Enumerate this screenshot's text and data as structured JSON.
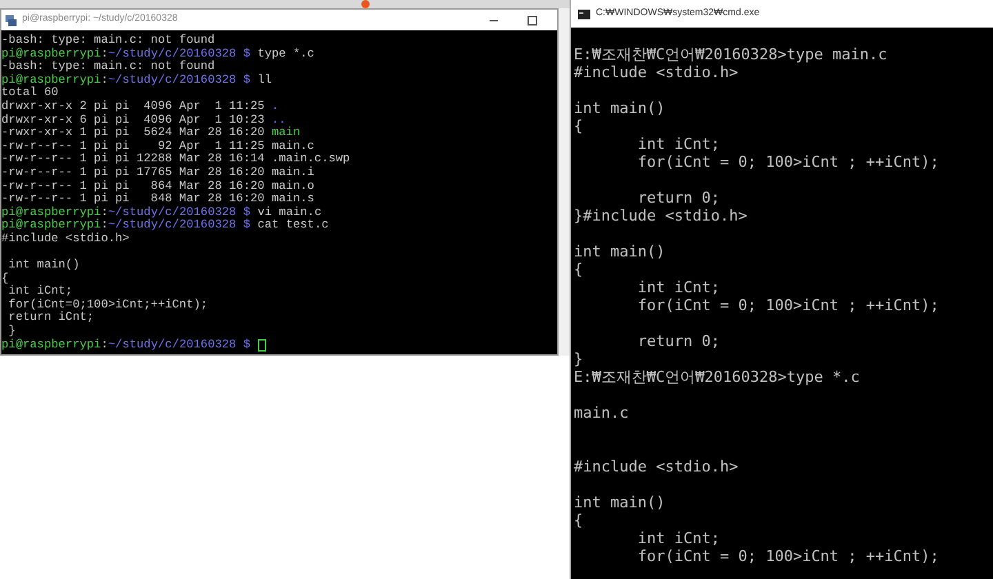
{
  "terminal": {
    "title": "pi@raspberrypi: ~/study/c/20160328",
    "lines": [
      {
        "segments": [
          {
            "text": "-bash: type: main.c: not found",
            "kind": "text"
          }
        ]
      },
      {
        "segments": [
          {
            "text": "pi@raspberrypi",
            "kind": "user"
          },
          {
            "text": ":",
            "kind": "text"
          },
          {
            "text": "~/study/c/20160328 $",
            "kind": "path"
          },
          {
            "text": " type *.c",
            "kind": "text"
          }
        ]
      },
      {
        "segments": [
          {
            "text": "-bash: type: main.c: not found",
            "kind": "text"
          }
        ]
      },
      {
        "segments": [
          {
            "text": "pi@raspberrypi",
            "kind": "user"
          },
          {
            "text": ":",
            "kind": "text"
          },
          {
            "text": "~/study/c/20160328 $",
            "kind": "path"
          },
          {
            "text": " ll",
            "kind": "text"
          }
        ]
      },
      {
        "segments": [
          {
            "text": "total 60",
            "kind": "text"
          }
        ]
      },
      {
        "segments": [
          {
            "text": "drwxr-xr-x 2 pi pi  4096 Apr  1 11:25 ",
            "kind": "text"
          },
          {
            "text": ".",
            "kind": "dir"
          }
        ]
      },
      {
        "segments": [
          {
            "text": "drwxr-xr-x 6 pi pi  4096 Apr  1 10:23 ",
            "kind": "text"
          },
          {
            "text": "..",
            "kind": "dir"
          }
        ]
      },
      {
        "segments": [
          {
            "text": "-rwxr-xr-x 1 pi pi  5624 Mar 28 16:20 ",
            "kind": "text"
          },
          {
            "text": "main",
            "kind": "exec"
          }
        ]
      },
      {
        "segments": [
          {
            "text": "-rw-r--r-- 1 pi pi    92 Apr  1 11:25 main.c",
            "kind": "text"
          }
        ]
      },
      {
        "segments": [
          {
            "text": "-rw-r--r-- 1 pi pi 12288 Mar 28 16:14 .main.c.swp",
            "kind": "text"
          }
        ]
      },
      {
        "segments": [
          {
            "text": "-rw-r--r-- 1 pi pi 17765 Mar 28 16:20 main.i",
            "kind": "text"
          }
        ]
      },
      {
        "segments": [
          {
            "text": "-rw-r--r-- 1 pi pi   864 Mar 28 16:20 main.o",
            "kind": "text"
          }
        ]
      },
      {
        "segments": [
          {
            "text": "-rw-r--r-- 1 pi pi   848 Mar 28 16:20 main.s",
            "kind": "text"
          }
        ]
      },
      {
        "segments": [
          {
            "text": "pi@raspberrypi",
            "kind": "user"
          },
          {
            "text": ":",
            "kind": "text"
          },
          {
            "text": "~/study/c/20160328 $",
            "kind": "path"
          },
          {
            "text": " vi main.c",
            "kind": "text"
          }
        ]
      },
      {
        "segments": [
          {
            "text": "pi@raspberrypi",
            "kind": "user"
          },
          {
            "text": ":",
            "kind": "text"
          },
          {
            "text": "~/study/c/20160328 $",
            "kind": "path"
          },
          {
            "text": " cat test.c",
            "kind": "text"
          }
        ]
      },
      {
        "segments": [
          {
            "text": "#include <stdio.h>",
            "kind": "text"
          }
        ]
      },
      {
        "kind": "blank"
      },
      {
        "segments": [
          {
            "text": " int main()",
            "kind": "text"
          }
        ]
      },
      {
        "segments": [
          {
            "text": "{",
            "kind": "text"
          }
        ]
      },
      {
        "segments": [
          {
            "text": " int iCnt;",
            "kind": "text"
          }
        ]
      },
      {
        "segments": [
          {
            "text": " for(iCnt=0;100>iCnt;++iCnt);",
            "kind": "text"
          }
        ]
      },
      {
        "segments": [
          {
            "text": " return iCnt;",
            "kind": "text"
          }
        ]
      },
      {
        "segments": [
          {
            "text": " }",
            "kind": "text"
          }
        ]
      },
      {
        "segments": [
          {
            "text": "pi@raspberrypi",
            "kind": "user"
          },
          {
            "text": ":",
            "kind": "text"
          },
          {
            "text": "~/study/c/20160328 $",
            "kind": "path"
          }
        ],
        "cursor": true
      }
    ]
  },
  "cmd": {
    "title": "C:₩WINDOWS₩system32₩cmd.exe",
    "lines": [
      {
        "kind": "text",
        "text": "E:₩조재찬₩C언어₩20160328>type main.c"
      },
      {
        "kind": "text",
        "text": "#include <stdio.h>"
      },
      {
        "kind": "blank"
      },
      {
        "kind": "text",
        "text": "int main()"
      },
      {
        "kind": "text",
        "text": "{"
      },
      {
        "kind": "text",
        "text": "\tint iCnt;"
      },
      {
        "kind": "text",
        "text": "\tfor(iCnt = 0; 100>iCnt ; ++iCnt);"
      },
      {
        "kind": "blank"
      },
      {
        "kind": "text",
        "text": "\treturn 0;"
      },
      {
        "kind": "text",
        "text": "}#include <stdio.h>"
      },
      {
        "kind": "blank"
      },
      {
        "kind": "text",
        "text": "int main()"
      },
      {
        "kind": "text",
        "text": "{"
      },
      {
        "kind": "text",
        "text": "\tint iCnt;"
      },
      {
        "kind": "text",
        "text": "\tfor(iCnt = 0; 100>iCnt ; ++iCnt);"
      },
      {
        "kind": "blank"
      },
      {
        "kind": "text",
        "text": "\treturn 0;"
      },
      {
        "kind": "text",
        "text": "}"
      },
      {
        "kind": "text",
        "text": "E:₩조재찬₩C언어₩20160328>type *.c"
      },
      {
        "kind": "blank"
      },
      {
        "kind": "text",
        "text": "main.c"
      },
      {
        "kind": "blank"
      },
      {
        "kind": "blank"
      },
      {
        "kind": "text",
        "text": "#include <stdio.h>"
      },
      {
        "kind": "blank"
      },
      {
        "kind": "text",
        "text": "int main()"
      },
      {
        "kind": "text",
        "text": "{"
      },
      {
        "kind": "text",
        "text": "\tint iCnt;"
      },
      {
        "kind": "text",
        "text": "\tfor(iCnt = 0; 100>iCnt ; ++iCnt);"
      }
    ]
  }
}
